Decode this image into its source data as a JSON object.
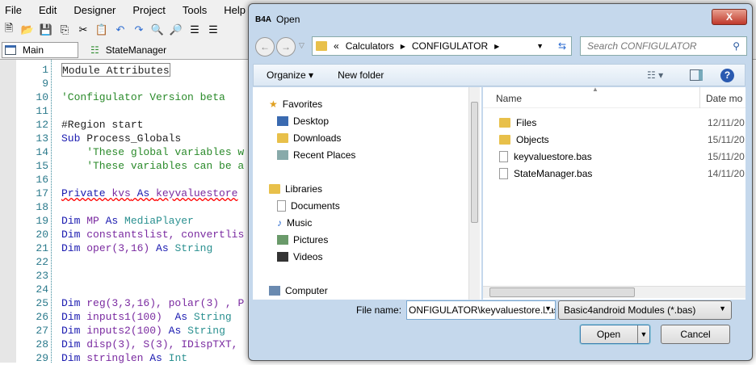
{
  "menu": [
    "File",
    "Edit",
    "Designer",
    "Project",
    "Tools",
    "Help"
  ],
  "tabs": {
    "main": "Main",
    "state": "StateManager"
  },
  "code": [
    {
      "n": "1",
      "t": [
        [
          "id",
          "Module Attributes"
        ]
      ]
    },
    {
      "n": "9",
      "t": []
    },
    {
      "n": "10",
      "t": [
        [
          "cm",
          "'Configulator Version beta"
        ]
      ]
    },
    {
      "n": "11",
      "t": []
    },
    {
      "n": "12",
      "t": [
        [
          "id",
          "#Region start"
        ]
      ]
    },
    {
      "n": "13",
      "t": [
        [
          "kw",
          "Sub "
        ],
        [
          "id",
          "Process_Globals"
        ]
      ]
    },
    {
      "n": "14",
      "t": [
        [
          "cm",
          "    'These global variables w"
        ]
      ]
    },
    {
      "n": "15",
      "t": [
        [
          "cm",
          "    'These variables can be a"
        ]
      ]
    },
    {
      "n": "16",
      "t": []
    },
    {
      "n": "17",
      "t": [
        [
          "kw",
          "Private "
        ],
        [
          "pu",
          "kvs"
        ],
        [
          "kw",
          " As "
        ],
        [
          "pu",
          "keyvaluestore"
        ]
      ]
    },
    {
      "n": "18",
      "t": []
    },
    {
      "n": "19",
      "t": [
        [
          "kw",
          "Dim "
        ],
        [
          "pu",
          "MP"
        ],
        [
          "kw",
          " As "
        ],
        [
          "ty",
          "MediaPlayer"
        ]
      ]
    },
    {
      "n": "20",
      "t": [
        [
          "kw",
          "Dim "
        ],
        [
          "pu",
          "constantslist, convertlis"
        ]
      ]
    },
    {
      "n": "21",
      "t": [
        [
          "kw",
          "Dim "
        ],
        [
          "pu",
          "oper(3,16)"
        ],
        [
          "kw",
          " As "
        ],
        [
          "ty",
          "String"
        ]
      ]
    },
    {
      "n": "22",
      "t": []
    },
    {
      "n": "23",
      "t": []
    },
    {
      "n": "24",
      "t": []
    },
    {
      "n": "25",
      "t": [
        [
          "kw",
          "Dim "
        ],
        [
          "pu",
          "reg(3,3,16), polar(3) , P"
        ]
      ]
    },
    {
      "n": "26",
      "t": [
        [
          "kw",
          "Dim "
        ],
        [
          "pu",
          "inputs1(100) "
        ],
        [
          "kw",
          " As "
        ],
        [
          "ty",
          "String"
        ]
      ]
    },
    {
      "n": "27",
      "t": [
        [
          "kw",
          "Dim "
        ],
        [
          "pu",
          "inputs2(100)"
        ],
        [
          "kw",
          " As "
        ],
        [
          "ty",
          "String"
        ]
      ]
    },
    {
      "n": "28",
      "t": [
        [
          "kw",
          "Dim "
        ],
        [
          "pu",
          "disp(3), S(3), IDispTXT,"
        ]
      ]
    },
    {
      "n": "29",
      "t": [
        [
          "kw",
          "Dim "
        ],
        [
          "pu",
          "stringlen"
        ],
        [
          "kw",
          " As "
        ],
        [
          "ty",
          "Int"
        ]
      ]
    }
  ],
  "dialog": {
    "app_badge": "B4A",
    "title": "Open",
    "close": "X",
    "path": {
      "prefix": "«",
      "parts": [
        "Calculators",
        "CONFIGULATOR"
      ]
    },
    "search_placeholder": "Search CONFIGULATOR",
    "organize": "Organize ▾",
    "new_folder": "New folder",
    "nav": {
      "favorites": "Favorites",
      "fav_items": [
        "Desktop",
        "Downloads",
        "Recent Places"
      ],
      "libraries": "Libraries",
      "lib_items": [
        "Documents",
        "Music",
        "Pictures",
        "Videos"
      ],
      "computer": "Computer"
    },
    "columns": {
      "name": "Name",
      "date": "Date mo"
    },
    "files": [
      {
        "name": "Files",
        "type": "folder",
        "date": "12/11/20"
      },
      {
        "name": "Objects",
        "type": "folder",
        "date": "15/11/20"
      },
      {
        "name": "keyvaluestore.bas",
        "type": "file",
        "date": "15/11/20"
      },
      {
        "name": "StateManager.bas",
        "type": "file",
        "date": "14/11/20"
      }
    ],
    "filename_label": "File name:",
    "filename_value": "ONFIGULATOR\\keyvaluestore.bas",
    "filter": "Basic4android Modules (*.bas)",
    "open": "Open",
    "cancel": "Cancel"
  }
}
